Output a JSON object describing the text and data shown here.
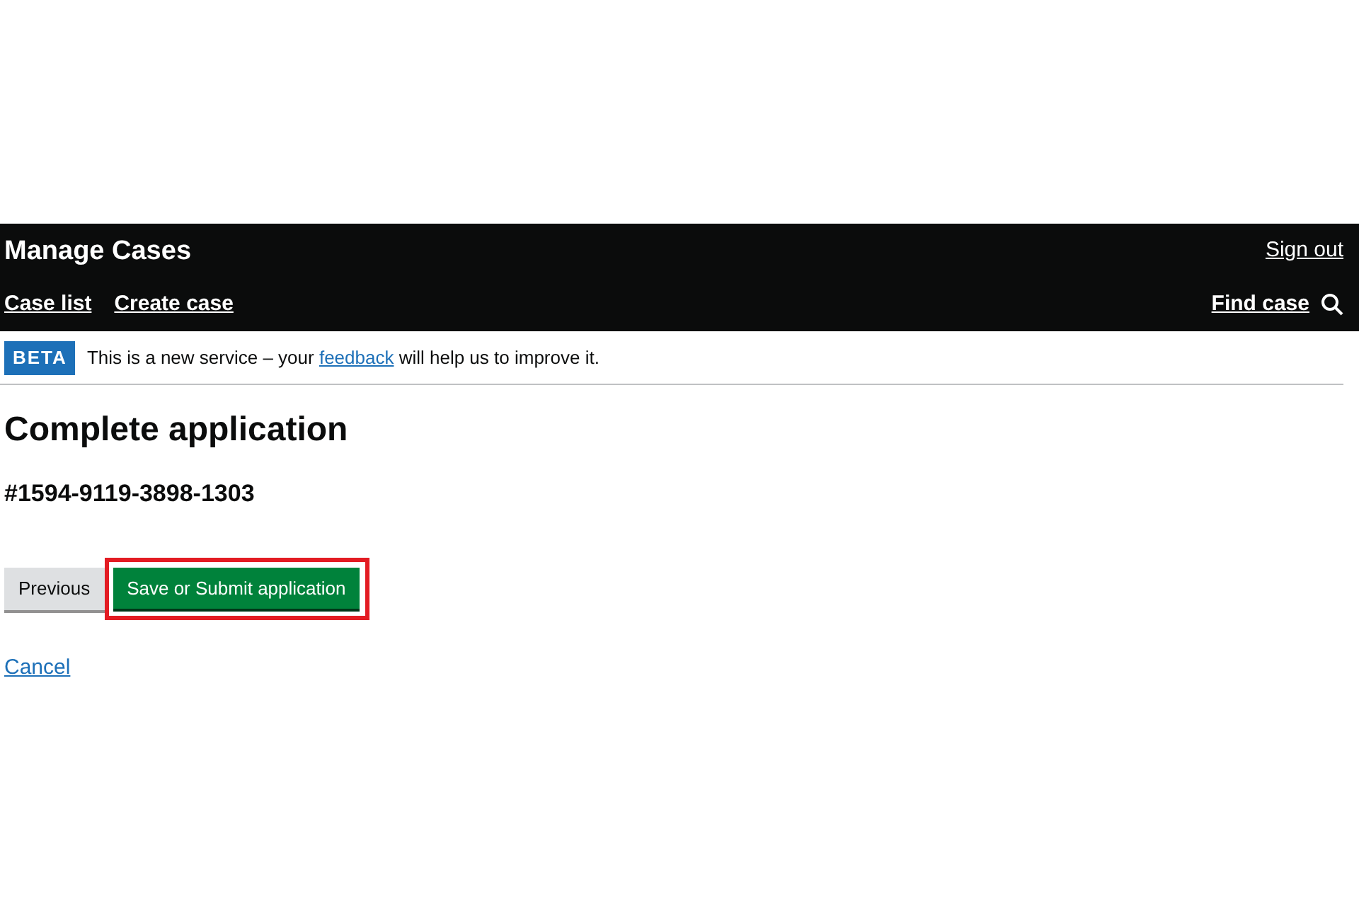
{
  "header": {
    "title": "Manage Cases",
    "sign_out": "Sign out",
    "nav": [
      {
        "label": "Case list"
      },
      {
        "label": "Create case"
      }
    ],
    "find": "Find case"
  },
  "phase_banner": {
    "tag": "BETA",
    "text_before": "This is a new service – your ",
    "link": "feedback",
    "text_after": " will help us to improve it."
  },
  "heading": "Complete application",
  "case_number": "#1594-9119-3898-1303",
  "buttons": [
    {
      "label": "Previous",
      "kind": "secondary",
      "highlighted": false
    },
    {
      "label": "Save or Submit application",
      "kind": "primary",
      "highlighted": true
    }
  ],
  "cancel": "Cancel"
}
